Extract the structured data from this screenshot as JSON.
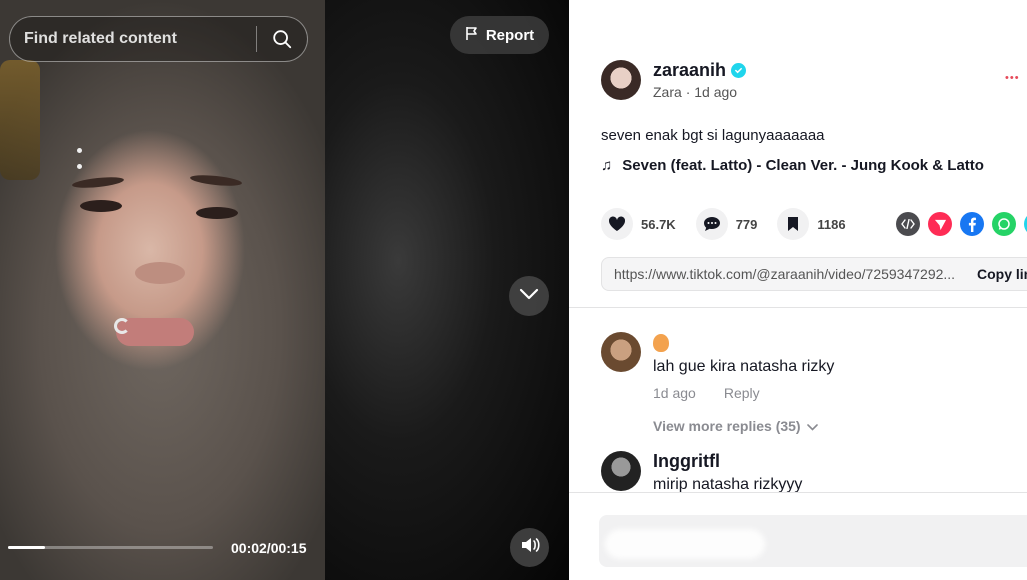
{
  "search": {
    "placeholder": "Find related content"
  },
  "report": {
    "label": "Report"
  },
  "player": {
    "time": "00:02/00:15",
    "progress_fraction": 0.18
  },
  "author": {
    "username": "zaraanih",
    "display_name": "Zara",
    "separator": "·",
    "posted": "1d ago"
  },
  "post": {
    "caption": "seven enak bgt si lagunyaaaaaaa",
    "music_note": "♫",
    "music": "Seven (feat. Latto) - Clean Ver. - Jung Kook & Latto"
  },
  "stats": {
    "likes": "56.7K",
    "comments": "779",
    "saves": "1186"
  },
  "share": {
    "link": "https://www.tiktok.com/@zaraanih/video/7259347292...",
    "copy_label": "Copy link"
  },
  "comments": [
    {
      "text": "lah gue kira natasha rizky",
      "time": "1d ago",
      "reply_label": "Reply",
      "more_replies": "View more replies (35)"
    },
    {
      "name": "Inggritfl",
      "text": "mirip natasha rizkyyy"
    }
  ],
  "colors": {
    "verified": "#20d5ec",
    "embed": "#4b4b4f",
    "friends": "#fe2c55",
    "facebook": "#1877f2",
    "whatsapp": "#25d366"
  }
}
